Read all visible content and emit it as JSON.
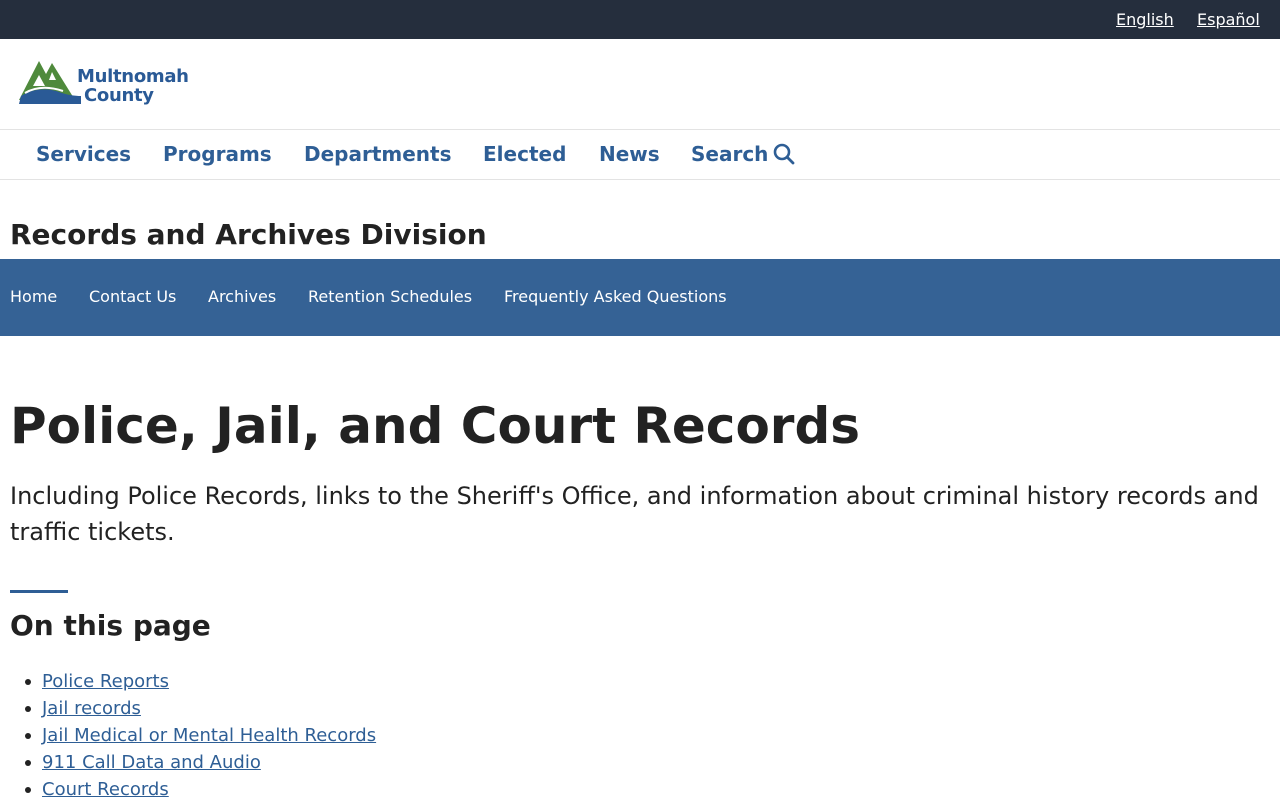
{
  "language_bar": {
    "english": "English",
    "spanish": "Español"
  },
  "logo": {
    "line1": "Multnomah",
    "line2": "County",
    "icon": "mountain-river-logo",
    "colors": {
      "mountain": "#4f8a3c",
      "river": "#2a5a96"
    }
  },
  "main_nav": {
    "items": [
      "Services",
      "Programs",
      "Departments",
      "Elected",
      "News",
      "Search"
    ],
    "search_icon": "magnifier-icon"
  },
  "division": {
    "title": "Records and Archives Division"
  },
  "sub_nav": {
    "items": [
      "Home",
      "Contact Us",
      "Archives",
      "Retention Schedules",
      "Frequently Asked Questions"
    ]
  },
  "page": {
    "title": "Police, Jail, and Court Records",
    "summary": "Including Police Records, links to the Sheriff's Office, and information about criminal history records and traffic tickets."
  },
  "toc": {
    "heading": "On this page",
    "items": [
      "Police Reports",
      "Jail records",
      "Jail Medical or Mental Health Records",
      "911 Call Data and Audio",
      "Court Records"
    ]
  },
  "colors": {
    "top_bar": "#252e3d",
    "accent": "#2e5e95",
    "sub_nav_bg": "#356295"
  }
}
